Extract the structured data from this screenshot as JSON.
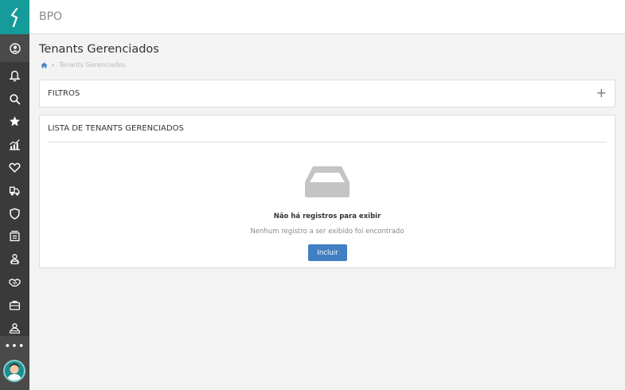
{
  "app": {
    "title": "BPO"
  },
  "sidebar": {
    "items": [
      {
        "icon": "user-circle-icon"
      },
      {
        "icon": "bell-icon"
      },
      {
        "icon": "search-icon"
      },
      {
        "icon": "star-icon"
      },
      {
        "icon": "chart-icon"
      },
      {
        "icon": "heart-icon"
      },
      {
        "icon": "forklift-icon"
      },
      {
        "icon": "shield-icon"
      },
      {
        "icon": "archive-icon"
      },
      {
        "icon": "team-icon"
      },
      {
        "icon": "handshake-icon"
      },
      {
        "icon": "briefcase-icon"
      },
      {
        "icon": "person-desk-icon"
      }
    ],
    "more_label": "•••"
  },
  "page": {
    "title": "Tenants Gerenciados",
    "breadcrumb": {
      "home_icon": "home-icon",
      "current": "Tenants Gerenciados"
    }
  },
  "filters": {
    "title": "FILTROS",
    "toggle_label": "+"
  },
  "list": {
    "title": "LISTA DE TENANTS GERENCIADOS",
    "empty_icon": "inbox-icon",
    "empty_title": "Não há registros para exibir",
    "empty_subtitle": "Nenhum registro a ser exibido foi encontrado",
    "include_label": "Incluir"
  },
  "colors": {
    "sidebar_bg": "#3a3a3a",
    "logo_bg": "#169b9b",
    "primary_button": "#3f7fc2",
    "page_bg": "#f3f3f3"
  }
}
